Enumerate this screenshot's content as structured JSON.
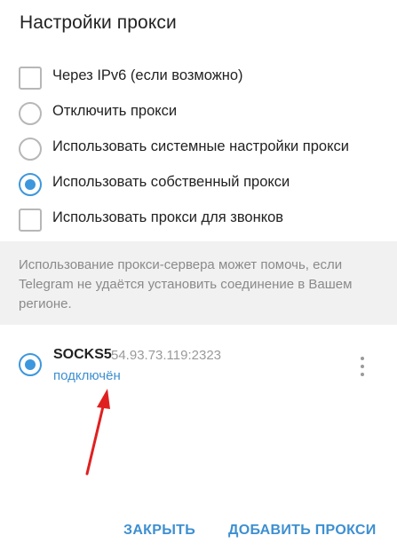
{
  "dialog": {
    "title": "Настройки прокси"
  },
  "options": [
    {
      "label": "Через IPv6 (если возможно)",
      "type": "checkbox",
      "checked": false
    },
    {
      "label": "Отключить прокси",
      "type": "radio",
      "checked": false
    },
    {
      "label": "Использовать системные настройки прокси",
      "type": "radio",
      "checked": false
    },
    {
      "label": "Использовать собственный прокси",
      "type": "radio",
      "checked": true
    },
    {
      "label": "Использовать прокси для звонков",
      "type": "checkbox",
      "checked": false
    }
  ],
  "info": {
    "text": "Использование прокси-сервера может помочь, если Telegram не удаётся установить соединение в Вашем регионе."
  },
  "proxy": {
    "name": "SOCKS5",
    "address": "54.93.73.119:2323",
    "status": "подключён",
    "selected": true
  },
  "buttons": {
    "close": "ЗАКРЫТЬ",
    "add": "ДОБАВИТЬ ПРОКСИ"
  },
  "colors": {
    "accent": "#3d97dd",
    "link": "#3d8fd1",
    "annotation_arrow": "#e02020"
  },
  "icons": {
    "more": "more-vertical-icon"
  }
}
